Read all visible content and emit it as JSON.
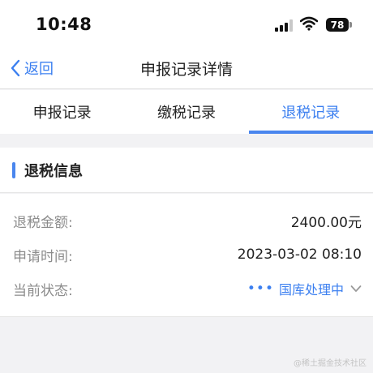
{
  "status_bar": {
    "time": "10:48",
    "battery": "78"
  },
  "nav": {
    "back_label": "返回",
    "title": "申报记录详情"
  },
  "tabs": [
    {
      "label": "申报记录",
      "active": false
    },
    {
      "label": "缴税记录",
      "active": false
    },
    {
      "label": "退税记录",
      "active": true
    }
  ],
  "section": {
    "title": "退税信息"
  },
  "details": {
    "amount_label": "退税金额:",
    "amount_value": "2400.00元",
    "time_label": "申请时间:",
    "time_value": "2023-03-02 08:10",
    "status_label": "当前状态:",
    "status_value": "国库处理中",
    "status_dots": "•••"
  },
  "watermark": "@稀土掘金技术社区",
  "colors": {
    "accent": "#3b7ff0",
    "background": "#f2f2f4"
  },
  "icons": [
    "back-chevron-icon",
    "signal-icon",
    "wifi-icon",
    "battery-icon",
    "chevron-down-icon"
  ]
}
